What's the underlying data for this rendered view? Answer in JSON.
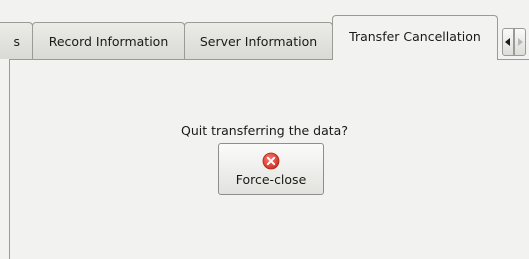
{
  "tabs": [
    {
      "label": "s",
      "partial": true
    },
    {
      "label": "Record Information"
    },
    {
      "label": "Server Information"
    },
    {
      "label": "Transfer Cancellation",
      "active": true
    }
  ],
  "tab_scroll": {
    "left_icon": "triangle-left",
    "right_icon": "triangle-right"
  },
  "panel": {
    "question": "Quit transferring the data?",
    "force_close_label": "Force-close",
    "force_close_icon": "cancel-circle",
    "icon_color": "#e53a2e"
  }
}
